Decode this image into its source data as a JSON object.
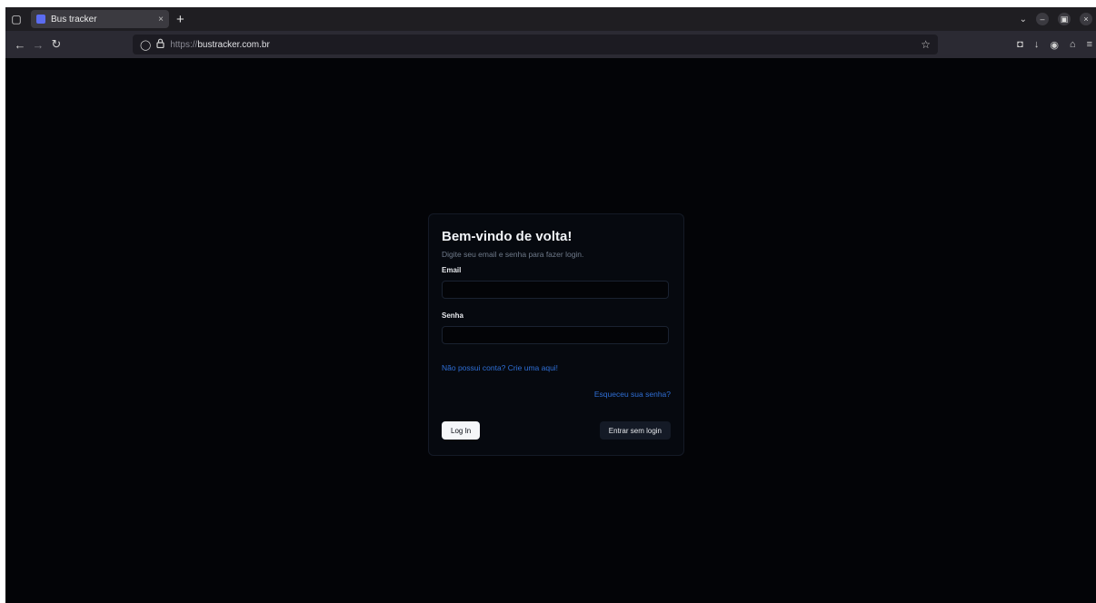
{
  "browser": {
    "tab": {
      "title": "Bus tracker",
      "close_icon": "×",
      "favicon": "bus-favicon"
    },
    "new_tab_label": "+",
    "address": {
      "scheme": "https://",
      "host": "bustracker.com.br"
    },
    "icons": {
      "tab_overview": "▢",
      "back": "←",
      "forward": "→",
      "reload": "↻",
      "shield": "◯",
      "lock": "🔒",
      "star": "☆",
      "pocket": "◘",
      "download": "↓",
      "account": "◉",
      "extensions": "⌂",
      "menu": "≡",
      "tabs_list": "⌄",
      "minimize": "–",
      "maximize": "▣",
      "close": "×"
    }
  },
  "login": {
    "title": "Bem-vindo de volta!",
    "description": "Digite seu email e senha para fazer login.",
    "email_label": "Email",
    "email_value": "",
    "password_label": "Senha",
    "password_value": "",
    "signup_link": "Não possui conta? Crie uma aqui!",
    "forgot_link": "Esqueceu sua senha?",
    "login_button": "Log In",
    "guest_button": "Entrar sem login"
  },
  "colors": {
    "page_background": "#030407",
    "card_background": "#06090f",
    "link": "#2f6fd6",
    "primary_button": "#f5f6f8"
  }
}
